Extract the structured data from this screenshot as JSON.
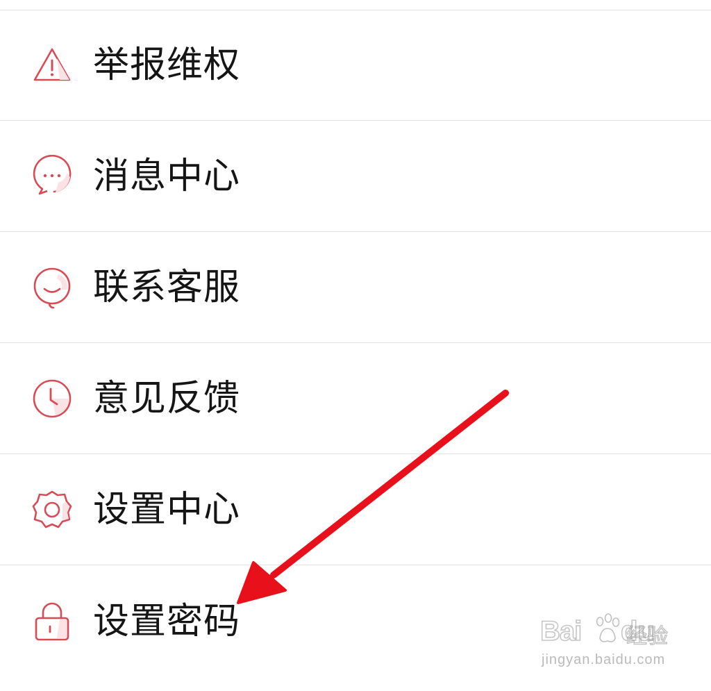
{
  "colors": {
    "icon_stroke": "#d84b55",
    "icon_fill_light": "#fbe3e5",
    "text": "#151515",
    "divider": "#e2e2e2",
    "arrow": "#e8101a"
  },
  "menu": {
    "items": [
      {
        "label": "举报维权",
        "icon": "warning-icon"
      },
      {
        "label": "消息中心",
        "icon": "message-icon"
      },
      {
        "label": "联系客服",
        "icon": "customer-service-icon"
      },
      {
        "label": "意见反馈",
        "icon": "clock-icon"
      },
      {
        "label": "设置中心",
        "icon": "gear-icon"
      },
      {
        "label": "设置密码",
        "icon": "lock-icon"
      }
    ]
  },
  "annotation": {
    "icon": "red-arrow-icon"
  },
  "watermark": {
    "brand_latin_1": "Bai",
    "brand_latin_2": "du",
    "brand_cn": "经验",
    "url": "jingyan.baidu.com"
  }
}
